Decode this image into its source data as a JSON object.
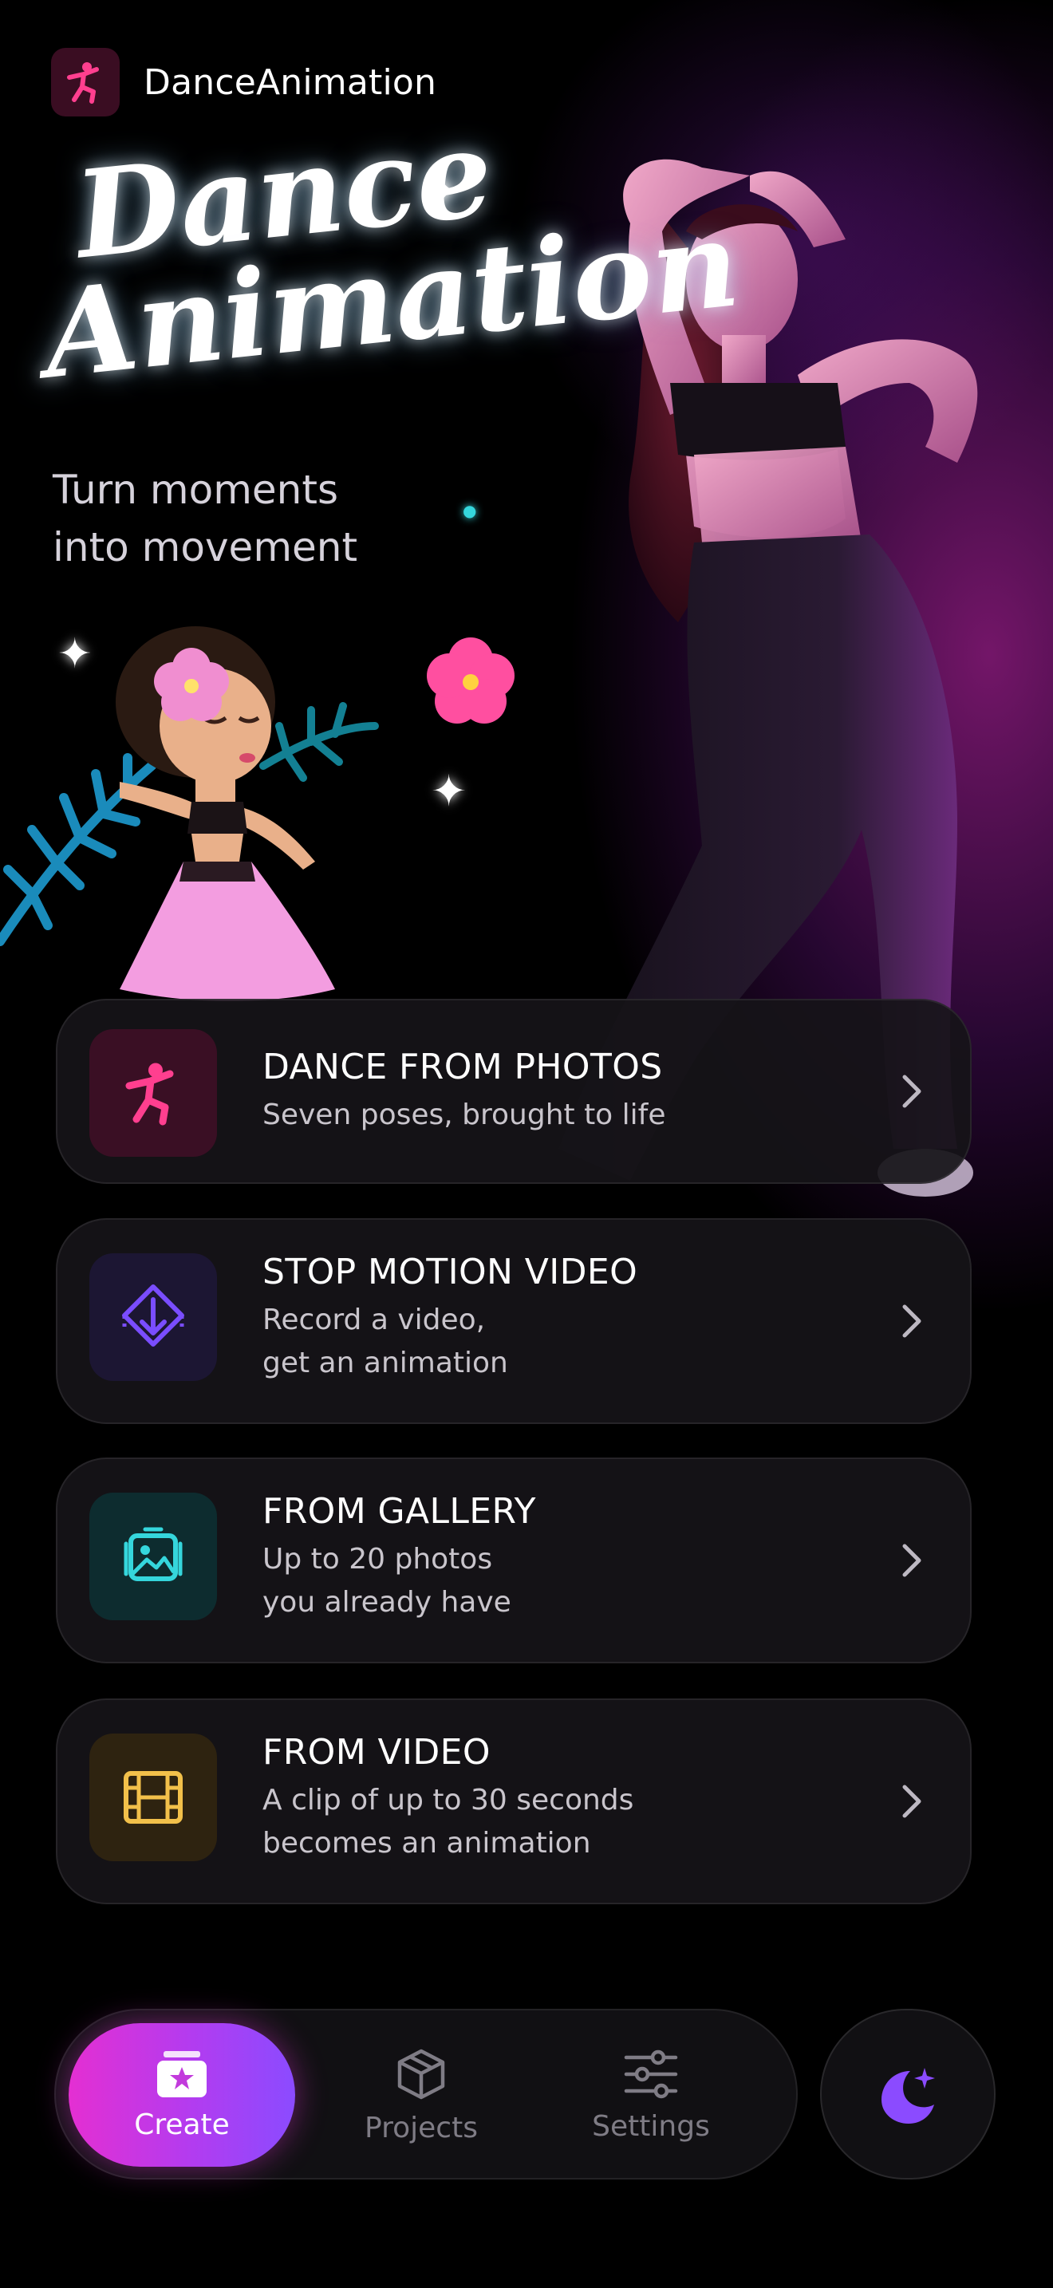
{
  "app": {
    "name": "DanceAnimation",
    "logo_icon": "dancer-icon",
    "accent_color": "#e42fd2"
  },
  "hero": {
    "title_line1": "Dance",
    "title_line2": "Animation",
    "subtitle_line1": "Turn moments",
    "subtitle_line2": "into movement"
  },
  "options": [
    {
      "title": "DANCE FROM PHOTOS",
      "subtitle_lines": [
        "Seven poses, brought to life"
      ],
      "icon": "dancer-icon",
      "icon_color": "#ff3f8f",
      "icon_bg": "#3a0f24"
    },
    {
      "title": "STOP MOTION VIDEO",
      "subtitle_lines": [
        "Record a video,",
        "get an animation"
      ],
      "icon": "motion-diamond-icon",
      "icon_color": "#7a4dff",
      "icon_bg": "#1c1633"
    },
    {
      "title": "FROM GALLERY",
      "subtitle_lines": [
        "Up to 20 photos",
        "you already have"
      ],
      "icon": "gallery-icon",
      "icon_color": "#35d6dc",
      "icon_bg": "#0d2c2f"
    },
    {
      "title": "FROM VIDEO",
      "subtitle_lines": [
        "A clip of up to 30 seconds",
        "becomes an animation"
      ],
      "icon": "film-icon",
      "icon_color": "#f2c04a",
      "icon_bg": "#2e2310"
    }
  ],
  "tabbar": {
    "tabs": [
      {
        "label": "Create",
        "icon": "create-star-icon",
        "selected": true
      },
      {
        "label": "Projects",
        "icon": "box-icon",
        "selected": false
      },
      {
        "label": "Settings",
        "icon": "sliders-icon",
        "selected": false
      }
    ],
    "theme_icon": "moon-sparkle-icon"
  }
}
